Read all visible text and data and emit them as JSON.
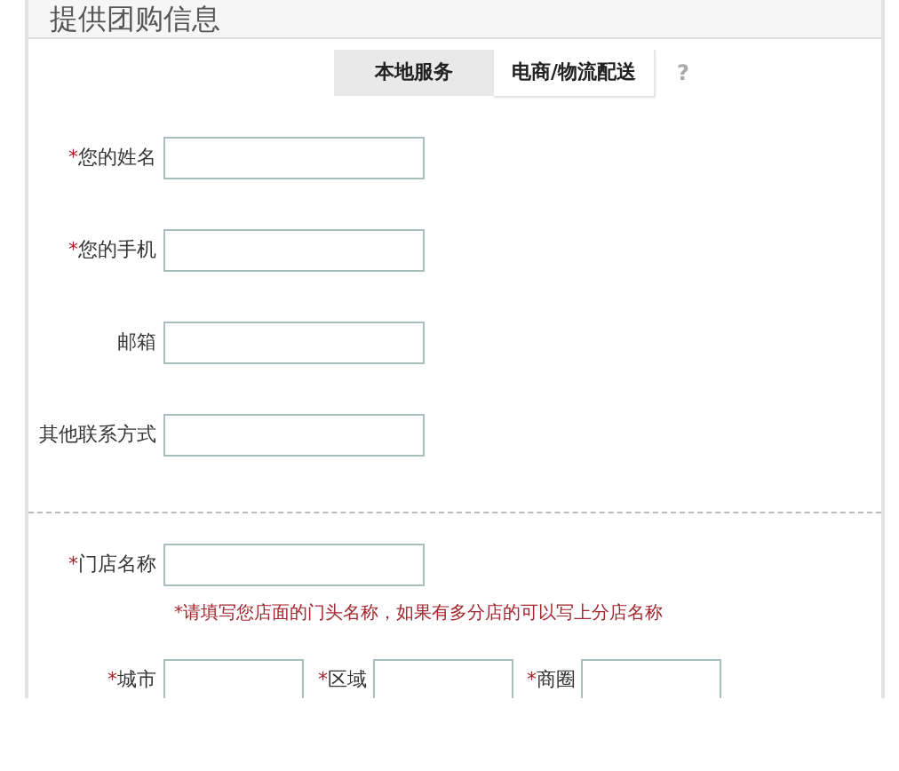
{
  "title": "提供团购信息",
  "tabs": [
    {
      "label": "本地服务",
      "selected": true
    },
    {
      "label": "电商/物流配送",
      "selected": false
    }
  ],
  "help": "?",
  "contact_fields": [
    {
      "label": "您的姓名",
      "required_mark": "*"
    },
    {
      "label": "您的手机",
      "required_mark": "*"
    },
    {
      "label": "邮箱"
    },
    {
      "label": "其他联系方式"
    }
  ],
  "store_field": {
    "label": "门店名称",
    "required_mark": "*",
    "hint": "*请填写您店面的门头名称，如果有多分店的可以写上分店名称"
  },
  "location_fields": [
    {
      "label": "城市",
      "required_mark": "*"
    },
    {
      "label": "区域",
      "required_mark": "*"
    },
    {
      "label": "商圈",
      "required_mark": "*"
    }
  ]
}
